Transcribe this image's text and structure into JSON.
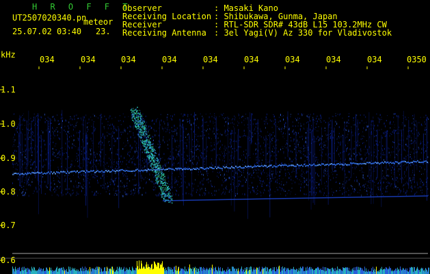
{
  "header": {
    "title": "H R O F F T",
    "filename": "UT2507020340.pn",
    "overlay_word": "meteor",
    "datetime": "25.07.02 03:40",
    "number": "23.",
    "info_labels": [
      "Observer",
      "Receiving Location",
      "Receiver",
      "Receiving Antenna"
    ],
    "info_values": [
      ": Masaki Kano",
      ": Shibukawa, Gunma, Japan",
      ": RTL-SDR SDR# 43dB L15 103.2MHz CW",
      ": 3el Yagi(V) Az 330 for Vladivostok"
    ]
  },
  "axis": {
    "unit": "kHz",
    "y_labels": [
      "1.1",
      "1.0",
      "0.9",
      "0.8",
      "0.7",
      "0.6"
    ],
    "time_labels": [
      "034",
      "034",
      "034",
      "034",
      "034",
      "034",
      "034",
      "034",
      "034",
      "0350"
    ]
  },
  "colors": {
    "background": "#000000",
    "text": "#ffff00",
    "title": "#33cc33",
    "signal_low": "#0a1f8c",
    "signal_high": "#2fe0d0"
  }
}
